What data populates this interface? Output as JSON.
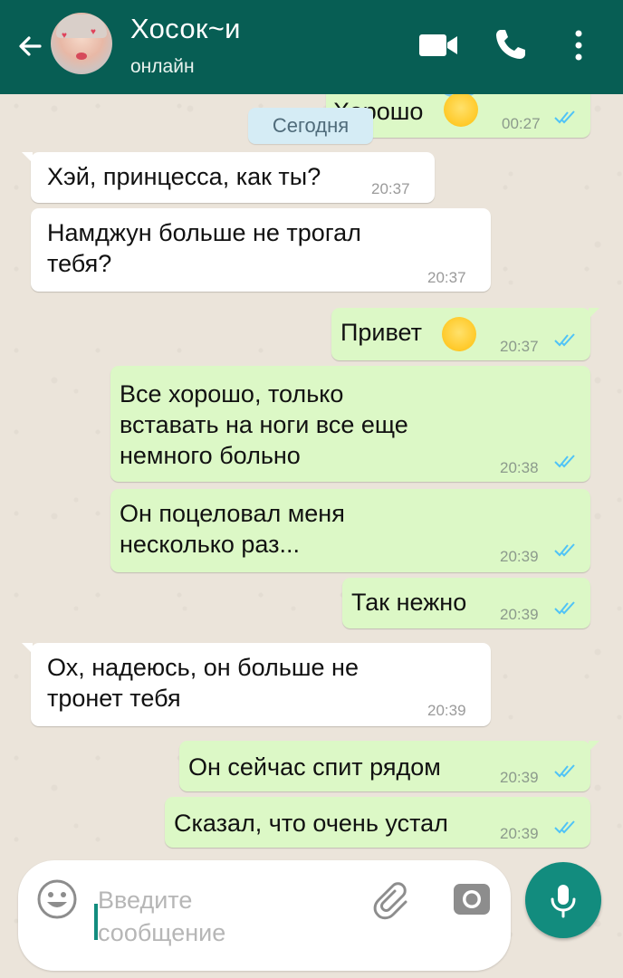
{
  "header": {
    "contact_name": "Хосок~и",
    "status": "онлайн"
  },
  "date_chip": "Сегодня",
  "messages": [
    {
      "dir": "out",
      "text": "Хорошо",
      "time": "00:27",
      "partial": true
    },
    {
      "dir": "in",
      "text": "Хэй, принцесса, как ты?",
      "time": "20:37"
    },
    {
      "dir": "in",
      "text": "Намджун больше не трогал\nтебя?",
      "time": "20:37"
    },
    {
      "dir": "out",
      "text": "Привет",
      "time": "20:37"
    },
    {
      "dir": "out",
      "text": "Все хорошо, только\nвставать на ноги все еще\nнемного больно",
      "time": "20:38"
    },
    {
      "dir": "out",
      "text": "Он поцеловал меня\nнесколько раз...",
      "time": "20:39"
    },
    {
      "dir": "out",
      "text": "Так нежно",
      "time": "20:39"
    },
    {
      "dir": "in",
      "text": "Ох, надеюсь, он больше не\nтронет тебя",
      "time": "20:39"
    },
    {
      "dir": "out",
      "text": "Он сейчас спит рядом",
      "time": "20:39"
    },
    {
      "dir": "out",
      "text": "Сказал, что очень устал",
      "time": "20:39"
    }
  ],
  "input": {
    "placeholder": "Введите\nсообщение"
  },
  "colors": {
    "header": "#075e54",
    "outgoing_bubble": "#dcf8c6",
    "incoming_bubble": "#ffffff",
    "read_ticks": "#4fc3f7",
    "mic_button": "#128c7e"
  },
  "icons": [
    "back-arrow-icon",
    "video-call-icon",
    "phone-icon",
    "more-vert-icon",
    "emoji-icon",
    "attach-clip-icon",
    "camera-icon",
    "mic-icon"
  ]
}
